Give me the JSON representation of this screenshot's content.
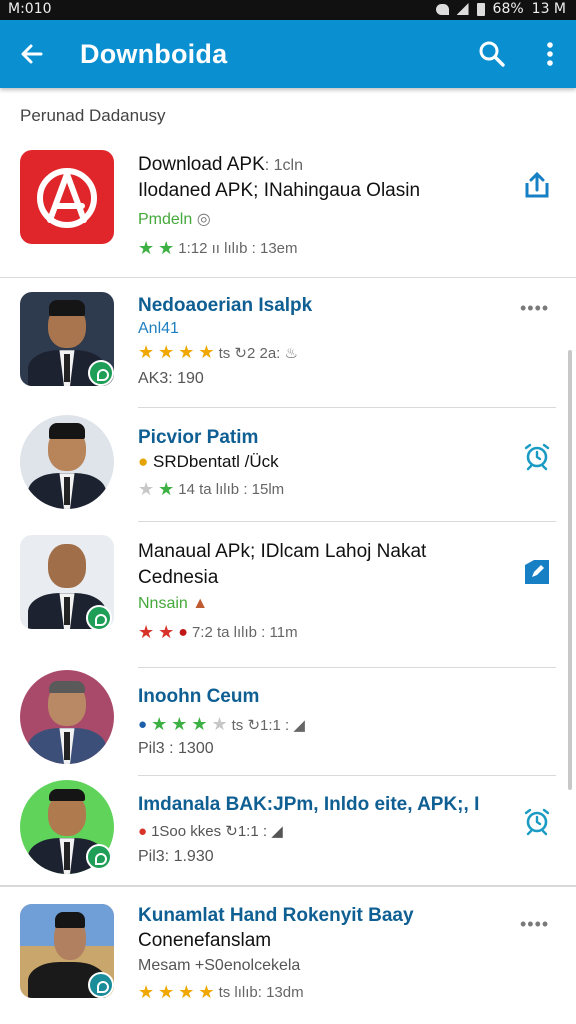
{
  "status_bar": {
    "time": "M:010",
    "battery": "68%",
    "clock": "13 M"
  },
  "app_bar": {
    "title": "Downboida"
  },
  "section": {
    "header": "Perunad Dadanusy"
  },
  "featured": {
    "title": "Download APK",
    "title_suffix": ": 1cln",
    "subtitle": "Ilodaned APK; INahingaua Olasin",
    "status": "Pmdeln",
    "rating_text": "1:12 ıı lılıb : 13em"
  },
  "items": [
    {
      "title": "Nedoaoerian Isalpk",
      "subtitle": "Anl41",
      "rating_text": "ts ↻2 2a: ♨",
      "meta": "AK3: 190",
      "action": "more",
      "badge": "green"
    },
    {
      "title": "Picvior Patim",
      "subtitle": "SRDbentatl /Ück",
      "rating_text": "14 ta lılıb : 15lm",
      "meta": "",
      "action": "alarm",
      "badge": "none"
    },
    {
      "title": "Manaual APk; IDlcam Lahoj Nakat",
      "subtitle": "Cednesia",
      "status": "Nnsain",
      "rating_text": "7:2 ta lılıb : 11m",
      "action": "edit",
      "badge": "green"
    },
    {
      "title": "Inoohn Ceum",
      "subtitle": "",
      "rating_text": "ts ↻1:1 : ◢",
      "meta": "Pil3 : 1300",
      "action": "none",
      "badge": "none"
    },
    {
      "title": "Imdanala BAK:JPm, Inldo eite, APK;, I",
      "subtitle": "1Soo kkes ↻1:1 : ◢",
      "meta": "Pil3: 1.930",
      "action": "alarm",
      "badge": "green"
    },
    {
      "title": "Kunamlat Hand Rokenyit Baay",
      "subtitle": "Conenefanslam",
      "status": "Mesam +S0enolcekela",
      "rating_text": "ts lılıb: 13dm",
      "action": "more",
      "badge": "teal"
    }
  ],
  "colors": {
    "app_bar": "#0a8fd0",
    "accent_blue": "#0f5f93",
    "green": "#45a93b",
    "star": "#f0a800"
  },
  "icons": [
    "back-arrow-icon",
    "search-icon",
    "more-vert-icon",
    "share-icon",
    "alarm-icon",
    "edit-icon"
  ]
}
